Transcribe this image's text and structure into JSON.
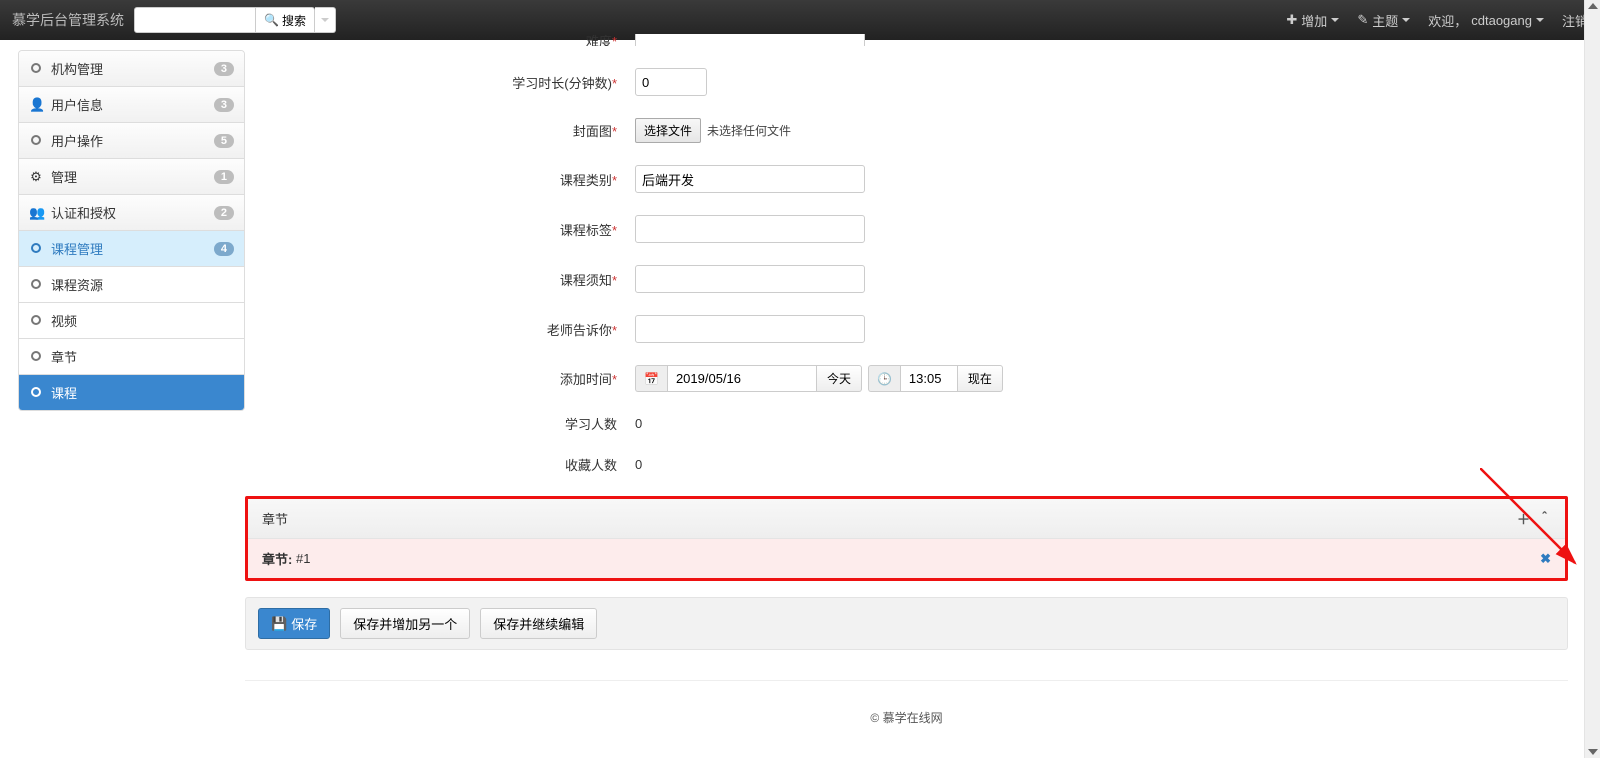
{
  "navbar": {
    "brand": "慕学后台管理系统",
    "search_btn": "搜索",
    "add": "增加",
    "theme": "主题",
    "welcome_prefix": "欢迎，",
    "username": "cdtaogang",
    "logout": "注销"
  },
  "sidebar": {
    "items": [
      {
        "label": "机构管理",
        "badge": "3",
        "icon": "circle"
      },
      {
        "label": "用户信息",
        "badge": "3",
        "icon": "user"
      },
      {
        "label": "用户操作",
        "badge": "5",
        "icon": "circle"
      },
      {
        "label": "管理",
        "badge": "1",
        "icon": "gear"
      },
      {
        "label": "认证和授权",
        "badge": "2",
        "icon": "group"
      },
      {
        "label": "课程管理",
        "badge": "4",
        "icon": "circle",
        "active_parent": true
      },
      {
        "label": "课程资源",
        "icon": "circle",
        "plain": true
      },
      {
        "label": "视频",
        "icon": "circle",
        "plain": true
      },
      {
        "label": "章节",
        "icon": "circle",
        "plain": true
      },
      {
        "label": "课程",
        "icon": "circle",
        "active": true
      }
    ]
  },
  "form": {
    "difficulty_label": "难度",
    "minutes_label": "学习时长(分钟数)",
    "minutes_value": "0",
    "cover_label": "封面图",
    "file_btn": "选择文件",
    "file_none": "未选择任何文件",
    "category_label": "课程类别",
    "category_value": "后端开发",
    "tag_label": "课程标签",
    "notes_label": "课程须知",
    "teacher_label": "老师告诉你",
    "addtime_label": "添加时间",
    "date_value": "2019/05/16",
    "today": "今天",
    "time_value": "13:05",
    "now": "现在",
    "learners_label": "学习人数",
    "learners_value": "0",
    "favs_label": "收藏人数",
    "favs_value": "0"
  },
  "chapter": {
    "header": "章节",
    "row_prefix": "章节:",
    "row_id": "#1"
  },
  "actions": {
    "save": "保存",
    "save_add": "保存并增加另一个",
    "save_cont": "保存并继续编辑"
  },
  "footer": "© 慕学在线网"
}
